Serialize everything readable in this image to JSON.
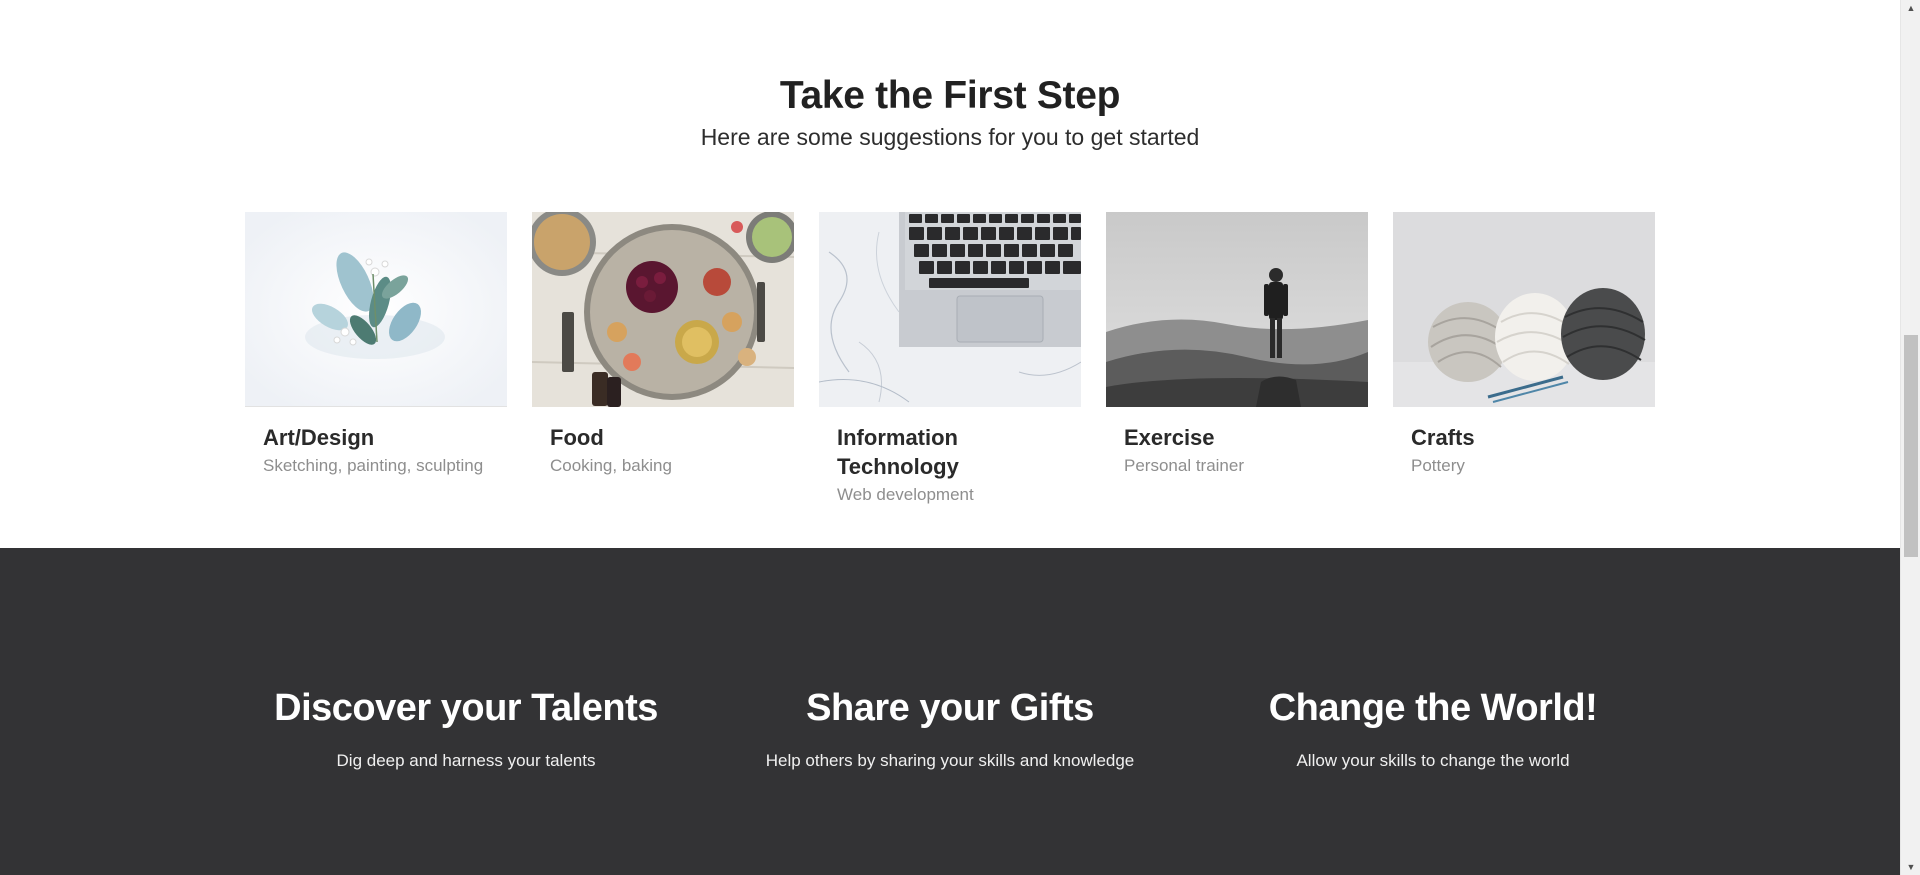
{
  "first_step": {
    "title": "Take the First Step",
    "subtitle": "Here are some suggestions for you to get started",
    "cards": [
      {
        "title": "Art/Design",
        "subtitle": "Sketching, painting, sculpting",
        "image": "flowers-photo"
      },
      {
        "title": "Food",
        "subtitle": "Cooking, baking",
        "image": "food-platter-photo"
      },
      {
        "title": "Information Technology",
        "subtitle": "Web development",
        "image": "laptop-keyboard-photo"
      },
      {
        "title": "Exercise",
        "subtitle": "Personal trainer",
        "image": "hiker-mountain-photo"
      },
      {
        "title": "Crafts",
        "subtitle": "Pottery",
        "image": "yarn-balls-photo"
      }
    ]
  },
  "features": [
    {
      "title": "Discover your Talents",
      "text": "Dig deep and harness your talents"
    },
    {
      "title": "Share your Gifts",
      "text": "Help others by sharing your skills and knowledge"
    },
    {
      "title": "Change the World!",
      "text": "Allow your skills to change the world"
    }
  ],
  "colors": {
    "dark_section": "#333335",
    "heading_text": "#212121",
    "muted_text": "#8e8e8e"
  },
  "scrollbar": {
    "up_icon": "triangle-up-icon",
    "down_icon": "triangle-down-icon"
  }
}
